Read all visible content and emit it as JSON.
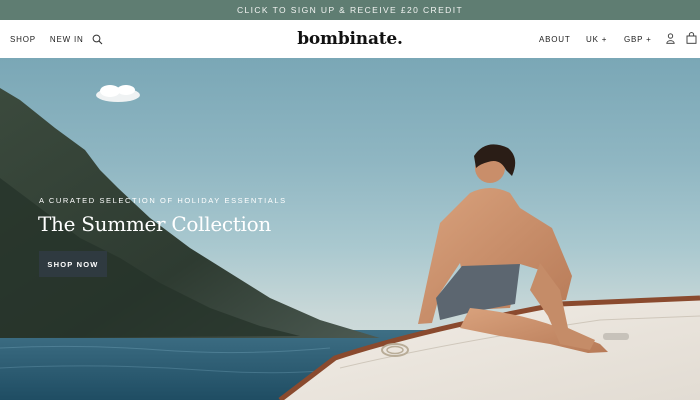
{
  "promo": {
    "text": "CLICK TO SIGN UP & RECEIVE £20 CREDIT"
  },
  "header": {
    "left_nav": {
      "shop": "SHOP",
      "new_in": "NEW IN"
    },
    "logo": "bombinate.",
    "right_nav": {
      "about": "ABOUT",
      "country": "UK +",
      "currency": "GBP +"
    }
  },
  "icons": {
    "search": "search-icon",
    "account": "user-icon",
    "bag": "shopping-bag-icon"
  },
  "hero": {
    "eyebrow": "A CURATED SELECTION OF HOLIDAY ESSENTIALS",
    "headline": "The Summer Collection",
    "cta_label": "SHOP NOW"
  },
  "colors": {
    "promo_bg": "#5f7d72",
    "cta_bg": "#2f3a40"
  }
}
